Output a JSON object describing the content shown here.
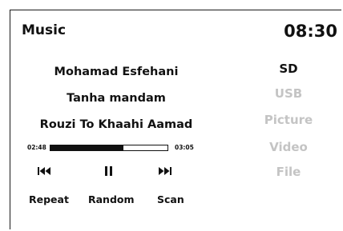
{
  "header": {
    "title": "Music",
    "clock": "08:30"
  },
  "now_playing": {
    "artist": "Mohamad Esfehani",
    "album": "Tanha mandam",
    "song": "Rouzi To Khaahi Aamad",
    "elapsed": "02:48",
    "duration": "03:05",
    "progress_fraction": 0.62
  },
  "transport": {
    "prev_icon": "skip-previous-icon",
    "pause_icon": "pause-icon",
    "next_icon": "skip-next-icon"
  },
  "modes": {
    "repeat_label": "Repeat",
    "random_label": "Random",
    "scan_label": "Scan"
  },
  "sources": [
    {
      "label": "SD",
      "active": true
    },
    {
      "label": "USB",
      "active": false
    },
    {
      "label": "Picture",
      "active": false
    },
    {
      "label": "Video",
      "active": false
    },
    {
      "label": "File",
      "active": false
    }
  ],
  "colors": {
    "text": "#111111",
    "inactive": "#c4c4c4",
    "background": "#ffffff"
  }
}
